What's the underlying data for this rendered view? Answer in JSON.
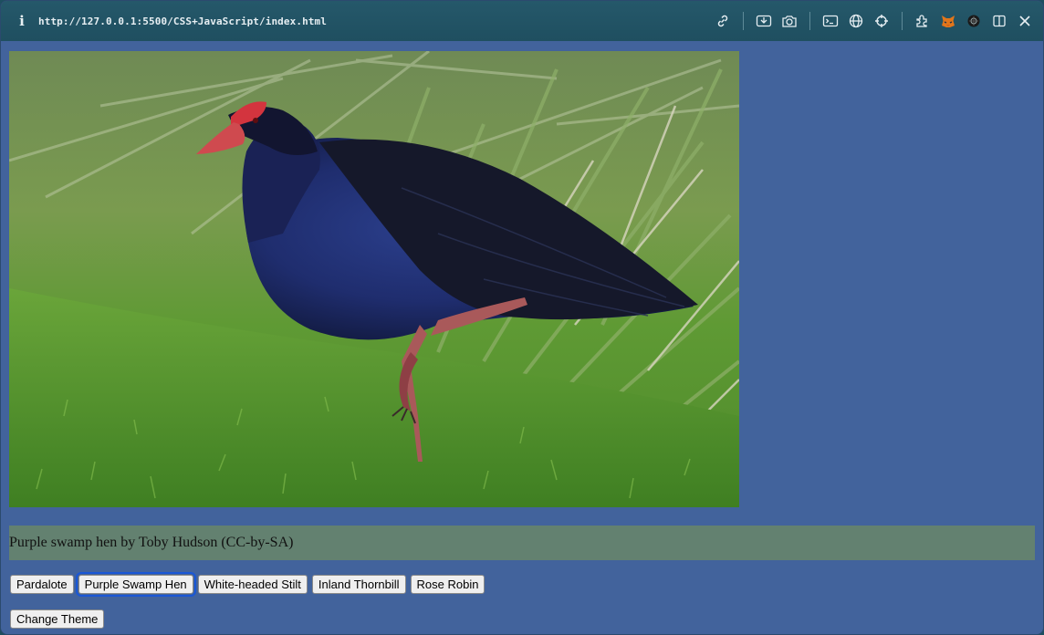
{
  "browser": {
    "info_icon": "i",
    "url": "http://127.0.0.1:5500/CSS+JavaScript/index.html",
    "icons": [
      "link-icon",
      "screenshot-icon",
      "camera-icon",
      "terminal-icon",
      "globe-icon",
      "crosshair-icon",
      "extensions-icon",
      "fox-icon",
      "bug-icon",
      "split-view-icon",
      "close-icon"
    ]
  },
  "photo": {
    "subject": "purple swamp hen standing on grass"
  },
  "caption": {
    "text": "Purple swamp hen by Toby Hudson (CC-by-SA)"
  },
  "bird_buttons": [
    {
      "label": "Pardalote"
    },
    {
      "label": "Purple Swamp Hen"
    },
    {
      "label": "White-headed Stilt"
    },
    {
      "label": "Inland Thornbill"
    },
    {
      "label": "Rose Robin"
    }
  ],
  "theme_button": {
    "label": "Change Theme"
  },
  "colors": {
    "page_background": "#42639c",
    "caption_background": "#638170",
    "toolbar_background": "#21536a"
  }
}
